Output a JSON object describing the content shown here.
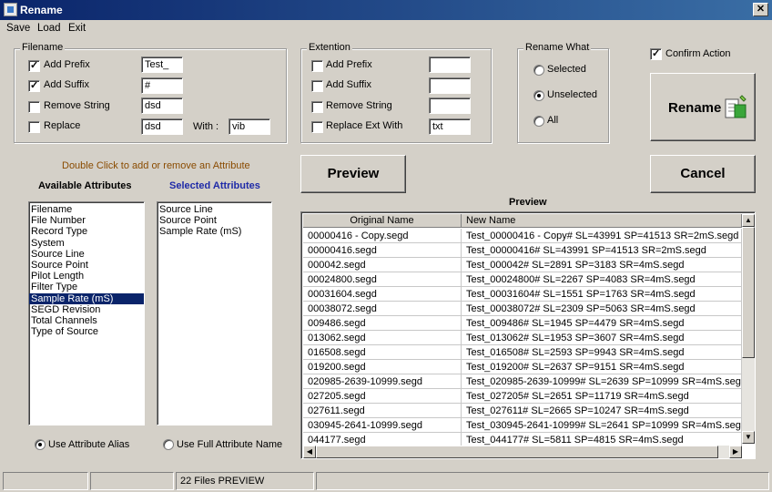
{
  "window": {
    "title": "Rename"
  },
  "menu": [
    "Save",
    "Load",
    "Exit"
  ],
  "filename": {
    "label": "Filename",
    "rows": [
      {
        "label": "Add Prefix",
        "checked": true,
        "value": "Test_"
      },
      {
        "label": "Add Suffix",
        "checked": true,
        "value": "#"
      },
      {
        "label": "Remove String",
        "checked": false,
        "value": "dsd"
      },
      {
        "label": "Replace",
        "checked": false,
        "value": "dsd"
      }
    ],
    "with_label": "With :",
    "with_value": "vib"
  },
  "extension": {
    "label": "Extention",
    "rows": [
      {
        "label": "Add Prefix",
        "checked": false,
        "value": ""
      },
      {
        "label": "Add Suffix",
        "checked": false,
        "value": ""
      },
      {
        "label": "Remove String",
        "checked": false,
        "value": ""
      },
      {
        "label": "Replace Ext With",
        "checked": false,
        "value": "txt"
      }
    ]
  },
  "rename_what": {
    "label": "Rename What",
    "options": [
      "Selected",
      "Unselected",
      "All"
    ],
    "selected": "Unselected"
  },
  "confirm_action": {
    "label": "Confirm Action",
    "checked": true
  },
  "buttons": {
    "rename": "Rename",
    "preview": "Preview",
    "cancel": "Cancel"
  },
  "attributes": {
    "hint": "Double Click to add or remove an Attribute",
    "available_title": "Available Attributes",
    "selected_title": "Selected Attributes",
    "available": [
      "Filename",
      "File Number",
      "Record Type",
      "System",
      "Source Line",
      "Source Point",
      "Pilot Length",
      "Filter Type",
      "Sample Rate (mS)",
      "SEGD Revision",
      "Total Channels",
      "Type of Source"
    ],
    "available_selected_index": 8,
    "selected": [
      "Source Line",
      "Source Point",
      "Sample Rate (mS)"
    ],
    "alias_option": "Use Attribute Alias",
    "full_name_option": "Use Full Attribute Name",
    "alias_selected": true
  },
  "preview": {
    "title": "Preview",
    "columns": [
      "Original Name",
      "New Name"
    ],
    "rows": [
      [
        "00000416 - Copy.segd",
        "Test_00000416 - Copy# SL=43991 SP=41513 SR=2mS.segd"
      ],
      [
        "00000416.segd",
        "Test_00000416# SL=43991 SP=41513 SR=2mS.segd"
      ],
      [
        "000042.segd",
        "Test_000042# SL=2891 SP=3183 SR=4mS.segd"
      ],
      [
        "00024800.segd",
        "Test_00024800# SL=2267 SP=4083 SR=4mS.segd"
      ],
      [
        "00031604.segd",
        "Test_00031604# SL=1551 SP=1763 SR=4mS.segd"
      ],
      [
        "00038072.segd",
        "Test_00038072# SL=2309 SP=5063 SR=4mS.segd"
      ],
      [
        "009486.segd",
        "Test_009486# SL=1945 SP=4479 SR=4mS.segd"
      ],
      [
        "013062.segd",
        "Test_013062# SL=1953 SP=3607 SR=4mS.segd"
      ],
      [
        "016508.segd",
        "Test_016508# SL=2593 SP=9943 SR=4mS.segd"
      ],
      [
        "019200.segd",
        "Test_019200# SL=2637 SP=9151 SR=4mS.segd"
      ],
      [
        "020985-2639-10999.segd",
        "Test_020985-2639-10999# SL=2639 SP=10999 SR=4mS.segd"
      ],
      [
        "027205.segd",
        "Test_027205# SL=2651 SP=11719 SR=4mS.segd"
      ],
      [
        "027611.segd",
        "Test_027611# SL=2665 SP=10247 SR=4mS.segd"
      ],
      [
        "030945-2641-10999.segd",
        "Test_030945-2641-10999# SL=2641 SP=10999 SR=4mS.segd"
      ],
      [
        "044177.segd",
        "Test_044177# SL=5811 SP=4815 SR=4mS.segd"
      ]
    ]
  },
  "status": {
    "panels": [
      "",
      "",
      "22 Files PREVIEW",
      ""
    ]
  }
}
